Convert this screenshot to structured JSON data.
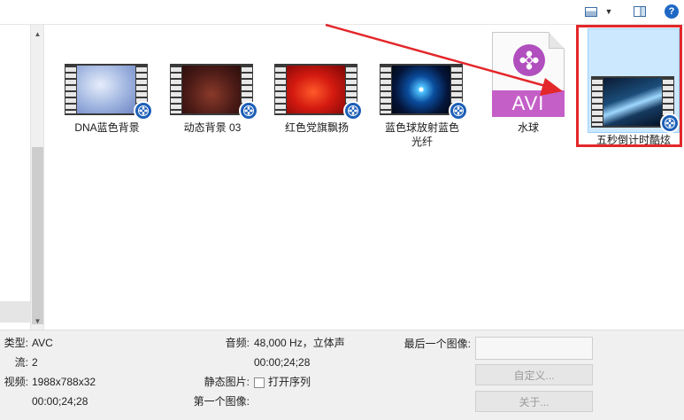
{
  "toolbar": {
    "view_dropdown_glyph": "▼",
    "help_glyph": "?"
  },
  "scrollbar": {
    "up_glyph": "▲",
    "down_glyph": "▼"
  },
  "files": [
    {
      "name": "DNA蓝色背景",
      "type": "video",
      "thumb": "blue-dna"
    },
    {
      "name": "动态背景 03",
      "type": "video",
      "thumb": "dark-red-particles"
    },
    {
      "name": "红色党旗飘扬",
      "type": "video",
      "thumb": "red-flag"
    },
    {
      "name": "蓝色球放射蓝色光纤",
      "type": "video",
      "thumb": "blue-radial"
    },
    {
      "name": "水球",
      "type": "avi",
      "badge": "AVI"
    },
    {
      "name": "五秒倒计时酷炫",
      "type": "video",
      "thumb": "countdown",
      "selected": true
    }
  ],
  "details": {
    "type_key": "类型:",
    "type_val": "AVC",
    "stream_key": "流:",
    "stream_val": "2",
    "video_key": "视频:",
    "video_val": "1988x788x32",
    "video_duration": "00:00;24;28",
    "audio_key": "音频:",
    "audio_val": "48,000 Hz，立体声",
    "audio_duration": "00:00;24;28",
    "still_key": "静态图片:",
    "still_check_label": "打开序列",
    "first_frame_key": "第一个图像:",
    "last_frame_key": "最后一个图像:",
    "custom_button": "自定义...",
    "about_button": "关于..."
  },
  "colors": {
    "highlight": "#e3272a",
    "selection": "#cce8ff",
    "badge": "#1d5fb8",
    "avi": "#c45fc8"
  }
}
